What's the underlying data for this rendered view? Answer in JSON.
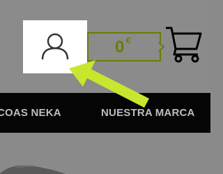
{
  "header": {
    "account_icon": "user-icon",
    "cart": {
      "total_value": "0",
      "currency": "€",
      "icon": "shopping-cart-icon"
    }
  },
  "nav": {
    "items": [
      {
        "label": "COAS NEKA"
      },
      {
        "label": "NUESTRA MARCA"
      }
    ]
  },
  "overlay": {
    "arrow_color": "#c8e62e",
    "accent_color": "#6a7d00"
  }
}
